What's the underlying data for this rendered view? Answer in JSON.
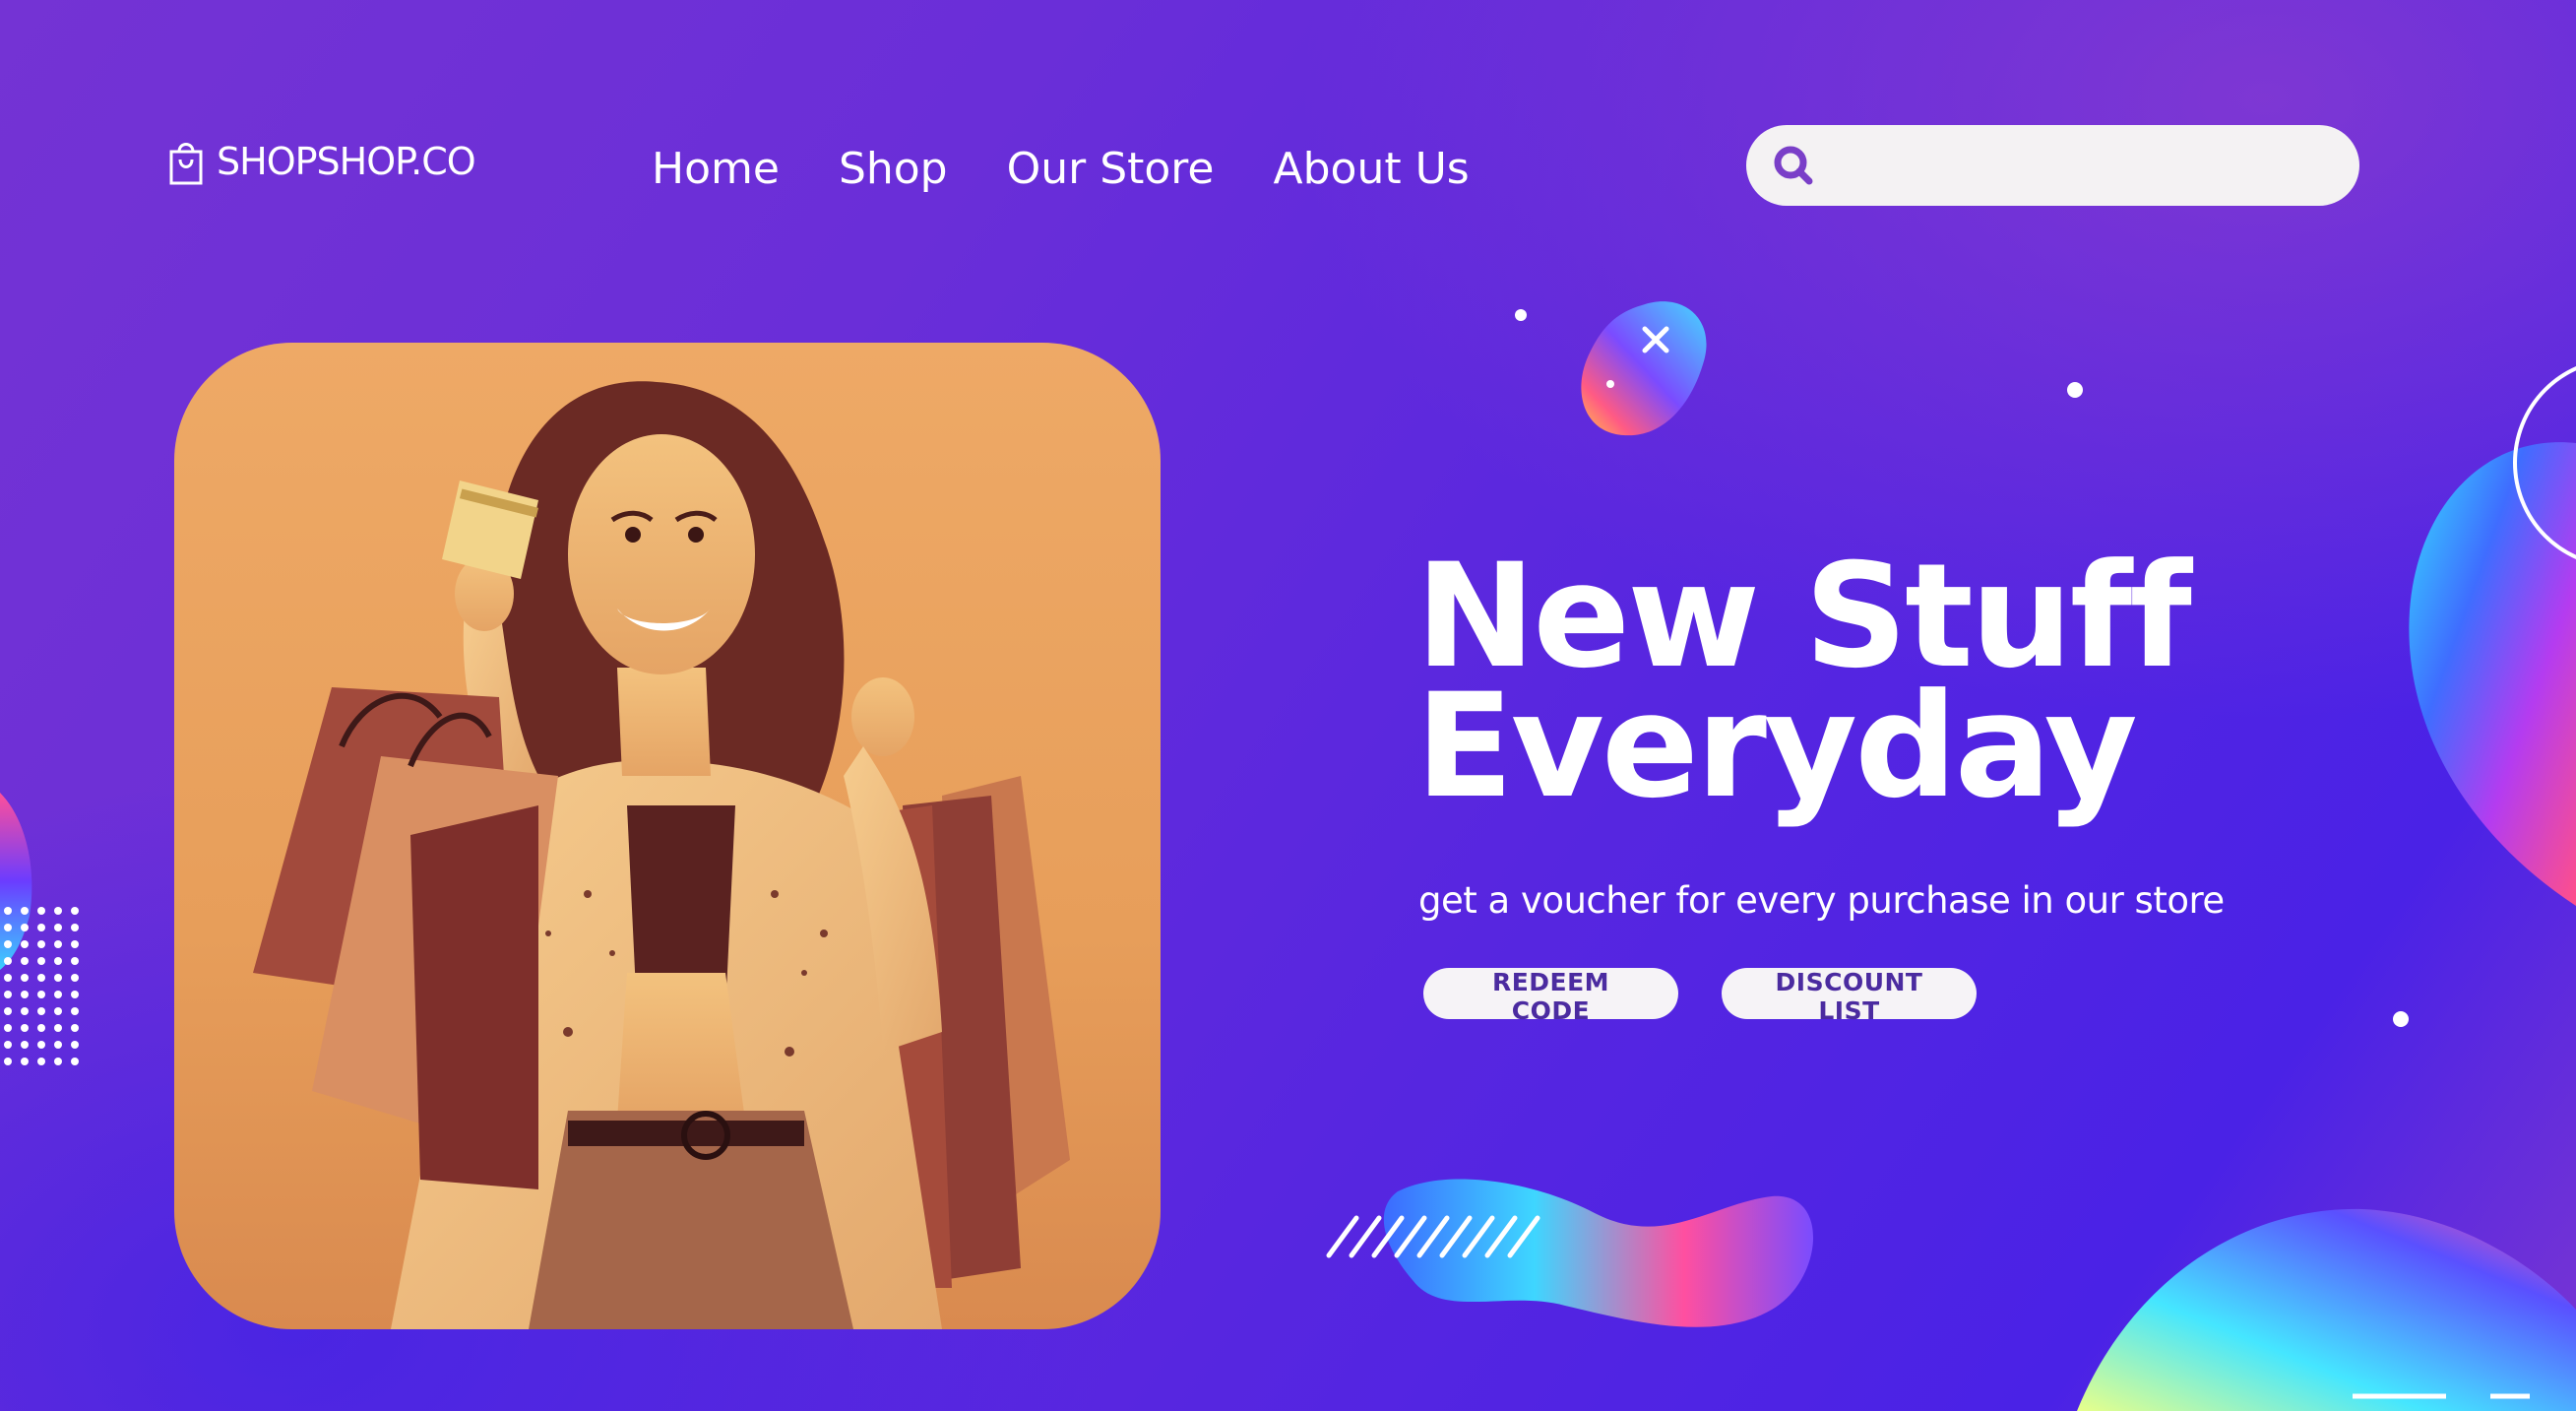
{
  "brand": {
    "name": "SHOPSHOP.CO"
  },
  "nav": {
    "items": [
      {
        "label": "Home"
      },
      {
        "label": "Shop"
      },
      {
        "label": "Our Store"
      },
      {
        "label": "About Us"
      }
    ]
  },
  "search": {
    "value": "",
    "placeholder": "",
    "icon": "search-icon"
  },
  "hero": {
    "headline_line1": "New Stuff",
    "headline_line2": "Everyday",
    "subtitle": "get a voucher for every purchase in our store",
    "buttons": {
      "redeem_label": "REDEEM CODE",
      "discount_label": "DISCOUNT LIST"
    },
    "image": "woman-holding-shopping-bags-and-card-photo"
  },
  "colors": {
    "background_start": "#7433d4",
    "background_end": "#4a22e6",
    "photo_tone": "#eea966",
    "button_text": "#4b2ba0",
    "button_bg": "#f6f3f7",
    "search_icon": "#7a3fc8"
  }
}
